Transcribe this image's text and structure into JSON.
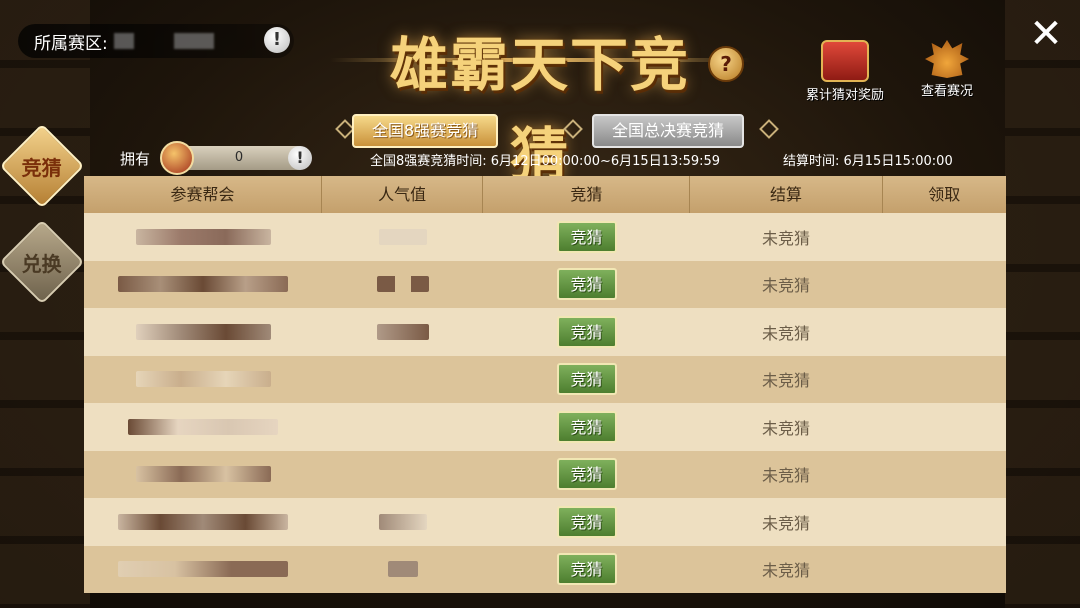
{
  "region": {
    "label": "所属赛区:"
  },
  "title": "雄霸天下竞猜",
  "help_icon": "?",
  "top_buttons": [
    {
      "label": "累计猜对奖励",
      "icon": "treasure-chest-icon"
    },
    {
      "label": "查看赛况",
      "icon": "crown-emblem-icon"
    }
  ],
  "close_icon": "✕",
  "tabs": [
    {
      "label": "全国8强赛竞猜",
      "active": true
    },
    {
      "label": "全国总决赛竞猜",
      "active": false
    }
  ],
  "side_nav": [
    {
      "label": "竞猜",
      "active": true
    },
    {
      "label": "兑换",
      "active": false
    }
  ],
  "owned": {
    "label": "拥有",
    "value": "0",
    "info": "!"
  },
  "region_info": "!",
  "guess_time": "全国8强赛竞猜时间: 6月12日00:00:00~6月15日13:59:59",
  "settle_time": "结算时间: 6月15日15:00:00",
  "table": {
    "headers": [
      "参赛帮会",
      "人气值",
      "竞猜",
      "结算",
      "领取"
    ],
    "rows": [
      {
        "button": "竞猜",
        "status": "未竞猜"
      },
      {
        "button": "竞猜",
        "status": "未竞猜"
      },
      {
        "button": "竞猜",
        "status": "未竞猜"
      },
      {
        "button": "竞猜",
        "status": "未竞猜"
      },
      {
        "button": "竞猜",
        "status": "未竞猜"
      },
      {
        "button": "竞猜",
        "status": "未竞猜"
      },
      {
        "button": "竞猜",
        "status": "未竞猜"
      },
      {
        "button": "竞猜",
        "status": "未竞猜"
      }
    ]
  }
}
